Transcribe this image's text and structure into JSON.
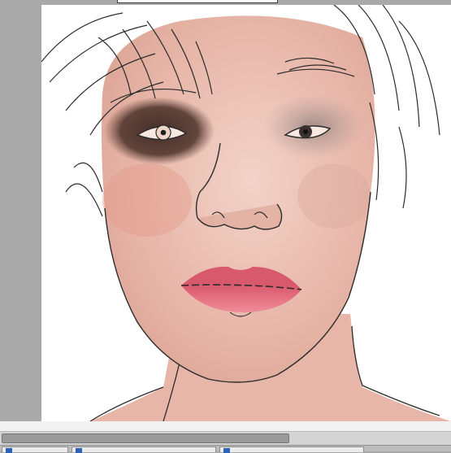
{
  "app": {
    "title_field": ""
  },
  "canvas": {
    "artwork": "portrait-sketch"
  },
  "scrollbar": {
    "position_fraction": 0.0,
    "visible_fraction": 0.64
  },
  "bottom_panels": [
    {
      "label": "",
      "icon": "panel-icon"
    },
    {
      "label": "",
      "icon": "panel-icon"
    },
    {
      "label": "",
      "icon": "panel-icon"
    }
  ],
  "colors": {
    "workspace": "#a9a9a9",
    "canvas": "#ffffff",
    "skin": "#e6b3a6",
    "lips": "#e0707e",
    "eye_shadow": "#3e2a22",
    "line_art": "#2b2b2b",
    "tab_icon": "#2e62b8"
  }
}
